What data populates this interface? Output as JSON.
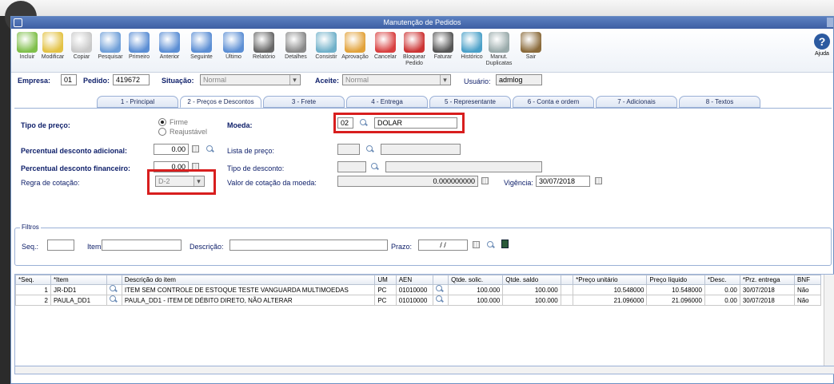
{
  "window": {
    "title": "Manutenção de Pedidos"
  },
  "toolbar": {
    "items": [
      {
        "label": "Incluir",
        "icon": "add-icon"
      },
      {
        "label": "Modificar",
        "icon": "edit-icon"
      },
      {
        "label": "Copiar",
        "icon": "copy-icon"
      },
      {
        "label": "Pesquisar",
        "icon": "search-icon"
      },
      {
        "label": "Primeiro",
        "icon": "first-icon"
      },
      {
        "label": "Anterior",
        "icon": "previous-icon"
      },
      {
        "label": "Seguinte",
        "icon": "next-icon"
      },
      {
        "label": "Último",
        "icon": "last-icon"
      },
      {
        "label": "Relatório",
        "icon": "printer-icon"
      },
      {
        "label": "Detalhes",
        "icon": "details-icon"
      },
      {
        "label": "Consistir",
        "icon": "validate-icon"
      },
      {
        "label": "Aprovação",
        "icon": "approval-icon"
      },
      {
        "label": "Cancelar",
        "icon": "cancel-icon"
      },
      {
        "label": "Bloquear Pedido",
        "icon": "block-icon"
      },
      {
        "label": "Faturar",
        "icon": "invoice-icon"
      },
      {
        "label": "Histórico",
        "icon": "history-icon"
      },
      {
        "label": "Manut. Duplicatas",
        "icon": "duplicates-icon"
      },
      {
        "label": "Sair",
        "icon": "exit-icon"
      }
    ],
    "help_label": "Ajuda"
  },
  "header": {
    "empresa_label": "Empresa:",
    "empresa_value": "01",
    "pedido_label": "Pedido:",
    "pedido_value": "419672",
    "situacao_label": "Situação:",
    "situacao_value": "Normal",
    "aceite_label": "Aceite:",
    "aceite_value": "Normal",
    "usuario_label": "Usuário:",
    "usuario_value": "admlog"
  },
  "tabs": [
    "1 - Principal",
    "2 - Preços e Descontos",
    "3 - Frete",
    "4 - Entrega",
    "5 - Representante",
    "6 - Conta e ordem",
    "7 - Adicionais",
    "8 - Textos"
  ],
  "form": {
    "tipo_preco_label": "Tipo de preço:",
    "radio_firme": "Firme",
    "radio_reajustavel": "Reajustável",
    "moeda_label": "Moeda:",
    "moeda_code": "02",
    "moeda_name": "DOLAR",
    "perc_adicional_label": "Percentual desconto adicional:",
    "perc_adicional_value": "0.00",
    "lista_preco_label": "Lista de preço:",
    "perc_financeiro_label": "Percentual desconto financeiro:",
    "perc_financeiro_value": "0.00",
    "tipo_desconto_label": "Tipo de desconto:",
    "regra_label": "Regra de cotação:",
    "regra_value": "D-2",
    "valor_cotacao_label": "Valor de cotação da moeda:",
    "valor_cotacao_value": "0.000000000",
    "vigencia_label": "Vigência:",
    "vigencia_value": "30/07/2018"
  },
  "filtros": {
    "legend": "Filtros",
    "seq_label": "Seq.:",
    "item_label": "Item:",
    "descricao_label": "Descrição:",
    "prazo_label": "Prazo:",
    "prazo_value": "/ /"
  },
  "grid": {
    "columns": [
      "*Seq.",
      "*Item",
      "",
      "Descrição do item",
      "UM",
      "AEN",
      "",
      "Qtde. solic.",
      "Qtde. saldo",
      "",
      "*Preço unitário",
      "Preço líquido",
      "*Desc.",
      "*Prz. entrega",
      "BNF"
    ],
    "rows": [
      [
        "1",
        "JR-DD1",
        "",
        "ITEM SEM CONTROLE DE ESTOQUE TESTE VANGUARDA MULTIMOEDAS",
        "PC",
        "01010000",
        "",
        "100.000",
        "100.000",
        "",
        "10.548000",
        "10.548000",
        "0.00",
        "30/07/2018",
        "Não"
      ],
      [
        "2",
        "PAULA_DD1",
        "",
        "PAULA_DD1 - ITEM DE DÉBITO DIRETO, NÃO ALTERAR",
        "PC",
        "01010000",
        "",
        "100.000",
        "100.000",
        "",
        "21.096000",
        "21.096000",
        "0.00",
        "30/07/2018",
        "Não"
      ]
    ]
  },
  "colors": {
    "accent": "#10216b",
    "highlight": "#d81e1e",
    "titlebar": "#4a6db3"
  }
}
